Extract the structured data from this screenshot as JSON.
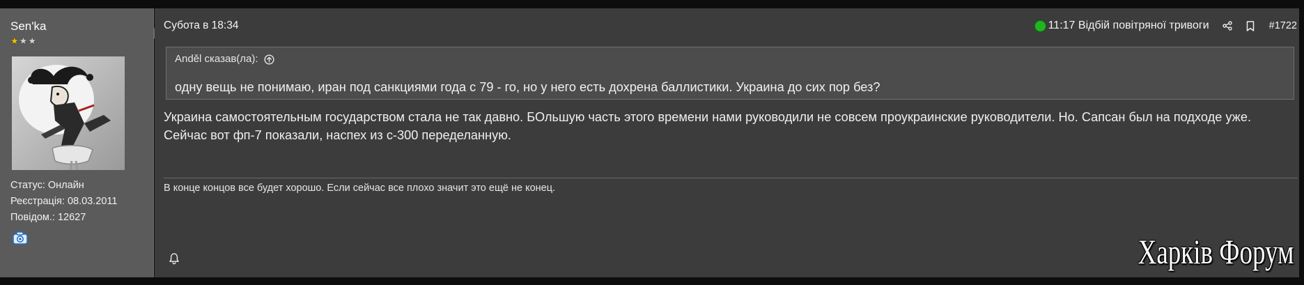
{
  "user": {
    "name": "Sen'ka",
    "stars": {
      "filled": 1,
      "total": 3,
      "filled_color": "#f0c000",
      "empty_color": "#d2d2d2"
    },
    "status": "Статус: Онлайн",
    "registered": "Реєстрація: 08.03.2011",
    "posts": "Повідом.: 12627"
  },
  "post": {
    "date": "Субота в 18:34",
    "alert": {
      "text": "11:17 Відбій повітряної тривоги",
      "dot_color": "#22b422"
    },
    "number": "#1722",
    "quote": {
      "author": "Anděl сказав(ла):",
      "text": "одну вещь не понимаю, иран под санкциями года с 79 - го, но у него есть дохрена баллистики. Украина до сих пор без?"
    },
    "body": "Украина самостоятельным государством стала не так давно. БОльшую часть этого времени нами руководили не совсем проукраинские руководители. Но. Сапсан был на подходе уже. Сейчас вот фп-7 показали, наспех из с-300 переделанную.",
    "signature": "В конце концов все будет хорошо. Если сейчас все плохо значит это ещё не конец."
  },
  "watermark": "Харків Форум",
  "icons": {
    "share": "share-icon",
    "bookmark": "bookmark-icon",
    "quote_jump": "arrow-up-circle-icon",
    "bell": "bell-icon",
    "badge": "camera-icon",
    "avatar": "jester-avatar"
  },
  "colors": {
    "sidebar": "#5b5b5b",
    "message": "#3c3c3c",
    "quote": "#4c4c4c",
    "text": "#eeeeee"
  }
}
